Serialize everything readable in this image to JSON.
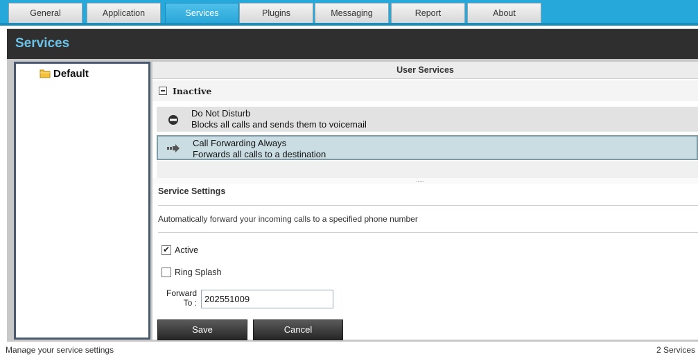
{
  "tabs": [
    {
      "label": "General",
      "active": false
    },
    {
      "label": "Application",
      "active": false
    },
    {
      "label": "Services",
      "active": true
    },
    {
      "label": "Plugins",
      "active": false
    },
    {
      "label": "Messaging",
      "active": false
    },
    {
      "label": "Report",
      "active": false
    },
    {
      "label": "About",
      "active": false
    }
  ],
  "window": {
    "title": "Services"
  },
  "tree": {
    "items": [
      {
        "label": "Default",
        "icon": "folder-icon"
      }
    ]
  },
  "user_services": {
    "header": "User Services",
    "group": {
      "label": "Inactive",
      "toggle_icon": "collapse-minus-icon"
    },
    "services": [
      {
        "name": "Do Not Disturb",
        "description": "Blocks all calls and sends them to voicemail",
        "icon": "do-not-disturb-icon",
        "selected": false
      },
      {
        "name": "Call Forwarding Always",
        "description": "Forwards all calls to a destination",
        "icon": "forward-arrow-icon",
        "selected": true
      }
    ]
  },
  "service_settings": {
    "title": "Service Settings",
    "description": "Automatically forward your incoming calls to a specified phone number",
    "active": {
      "label": "Active",
      "checked": true
    },
    "ring_splash": {
      "label": "Ring Splash",
      "checked": false
    },
    "forward_to": {
      "label_line1": "Forward",
      "label_line2": "To :",
      "value": "202551009"
    },
    "save_label": "Save",
    "cancel_label": "Cancel"
  },
  "statusbar": {
    "left": "Manage your service settings",
    "right": "2 Services"
  },
  "colors": {
    "tab_bar": "#27a8db",
    "title_text": "#6ac3e6",
    "title_bar": "#2f2f2f",
    "selected_row": "#c9dde3"
  }
}
